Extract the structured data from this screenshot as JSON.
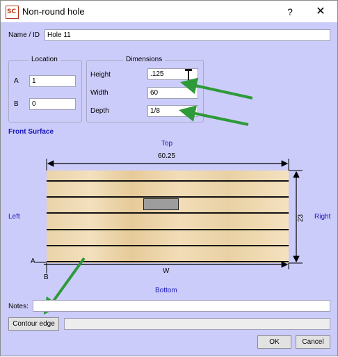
{
  "window": {
    "title": "Non-round hole",
    "app_icon_text": "SC",
    "help_symbol": "?",
    "close_symbol": "✕"
  },
  "name_id": {
    "label": "Name / ID",
    "value": "Hole 11"
  },
  "location": {
    "title": "Location",
    "a_label": "A",
    "a_value": "1",
    "b_label": "B",
    "b_value": "0"
  },
  "dimensions": {
    "title": "Dimensions",
    "height_label": "Height",
    "height_value": ".125",
    "width_label": "Width",
    "width_value": "60",
    "depth_label": "Depth",
    "depth_value": "1/8"
  },
  "diagram": {
    "section_label": "Front Surface",
    "top_label": "Top",
    "bottom_label": "Bottom",
    "left_label": "Left",
    "right_label": "Right",
    "width_dim": "60.25",
    "height_dim": "23",
    "w_marker": "W",
    "a_marker": "A",
    "b_marker": "B"
  },
  "notes": {
    "label": "Notes:",
    "value": ""
  },
  "contour": {
    "button_label": "Contour edge",
    "value": ""
  },
  "footer": {
    "ok_label": "OK",
    "cancel_label": "Cancel"
  },
  "colors": {
    "dialog_bg": "#ccccfa",
    "label_blue": "#1515b8",
    "annotation_arrow": "#2e9a3a",
    "hole_fill": "#9d9d9d"
  }
}
